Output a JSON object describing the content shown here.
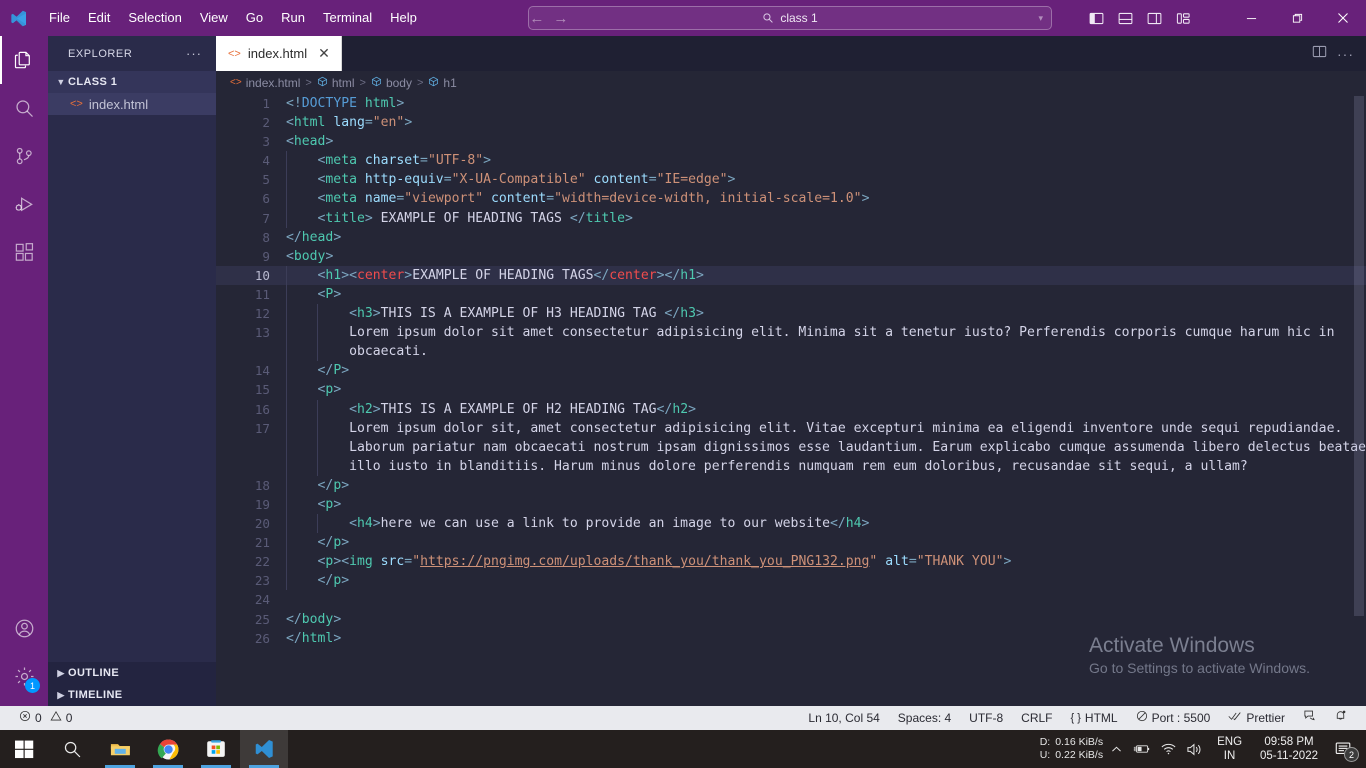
{
  "titlebar": {
    "logo_icon": "vscode-logo-icon",
    "menus": [
      "File",
      "Edit",
      "Selection",
      "View",
      "Go",
      "Run",
      "Terminal",
      "Help"
    ],
    "back_icon": "arrow-left-icon",
    "forward_icon": "arrow-right-icon",
    "command_center": {
      "search_icon": "search-icon",
      "value": "class 1",
      "chevron_icon": "chevron-down-icon"
    },
    "layout_buttons": [
      {
        "name": "toggle-primary-sidebar",
        "icon": "layout-sidebar-left-icon"
      },
      {
        "name": "toggle-panel",
        "icon": "layout-panel-icon"
      },
      {
        "name": "toggle-secondary-sidebar",
        "icon": "layout-sidebar-right-icon"
      },
      {
        "name": "customize-layout",
        "icon": "layout-customize-icon"
      }
    ],
    "window_buttons": {
      "minimize": "minimize-icon",
      "maximize": "restore-icon",
      "close": "close-icon"
    },
    "accent_color": "#68217a"
  },
  "activitybar": {
    "items": [
      {
        "name": "explorer",
        "icon": "files-icon",
        "active": true
      },
      {
        "name": "search",
        "icon": "search-icon",
        "active": false
      },
      {
        "name": "source-control",
        "icon": "source-control-icon",
        "active": false
      },
      {
        "name": "run-and-debug",
        "icon": "debug-icon",
        "active": false
      },
      {
        "name": "extensions",
        "icon": "extensions-icon",
        "active": false
      }
    ],
    "bottom": [
      {
        "name": "accounts",
        "icon": "account-icon"
      },
      {
        "name": "manage-settings",
        "icon": "gear-icon",
        "badge": "1"
      }
    ]
  },
  "sidebar": {
    "title": "EXPLORER",
    "more_actions": "···",
    "folder": {
      "label": "CLASS 1",
      "expanded": true
    },
    "files": [
      {
        "label": "index.html",
        "icon": "html-file-icon",
        "selected": true
      }
    ],
    "sections": [
      {
        "label": "OUTLINE",
        "expanded": false
      },
      {
        "label": "TIMELINE",
        "expanded": false
      }
    ]
  },
  "editor": {
    "tabs": [
      {
        "label": "index.html",
        "icon": "html-file-icon",
        "active": true,
        "close_icon": "close-icon"
      }
    ],
    "tab_actions": [
      {
        "name": "split-editor",
        "icon": "split-editor-icon"
      },
      {
        "name": "more-actions",
        "icon": "ellipsis-icon"
      }
    ],
    "breadcrumb": [
      "index.html",
      "html",
      "body",
      "h1"
    ],
    "watermark": {
      "title": "Activate Windows",
      "subtitle": "Go to Settings to activate Windows."
    },
    "current_line": 10,
    "lines": [
      {
        "n": 1,
        "indent": 0,
        "tokens": [
          {
            "c": "br",
            "t": "<!"
          },
          {
            "c": "dt",
            "t": "DOCTYPE"
          },
          {
            "c": "txt",
            "t": " "
          },
          {
            "c": "t",
            "t": "html"
          },
          {
            "c": "br",
            "t": ">"
          }
        ]
      },
      {
        "n": 2,
        "indent": 0,
        "tokens": [
          {
            "c": "br",
            "t": "<"
          },
          {
            "c": "t",
            "t": "html"
          },
          {
            "c": "txt",
            "t": " "
          },
          {
            "c": "a",
            "t": "lang"
          },
          {
            "c": "br",
            "t": "="
          },
          {
            "c": "s",
            "t": "\"en\""
          },
          {
            "c": "br",
            "t": ">"
          }
        ]
      },
      {
        "n": 3,
        "indent": 0,
        "tokens": [
          {
            "c": "br",
            "t": "<"
          },
          {
            "c": "t",
            "t": "head"
          },
          {
            "c": "br",
            "t": ">"
          }
        ]
      },
      {
        "n": 4,
        "indent": 1,
        "tokens": [
          {
            "c": "br",
            "t": "    <"
          },
          {
            "c": "t",
            "t": "meta"
          },
          {
            "c": "txt",
            "t": " "
          },
          {
            "c": "a",
            "t": "charset"
          },
          {
            "c": "br",
            "t": "="
          },
          {
            "c": "s",
            "t": "\"UTF-8\""
          },
          {
            "c": "br",
            "t": ">"
          }
        ]
      },
      {
        "n": 5,
        "indent": 1,
        "tokens": [
          {
            "c": "br",
            "t": "    <"
          },
          {
            "c": "t",
            "t": "meta"
          },
          {
            "c": "txt",
            "t": " "
          },
          {
            "c": "a",
            "t": "http-equiv"
          },
          {
            "c": "br",
            "t": "="
          },
          {
            "c": "s",
            "t": "\"X-UA-Compatible\""
          },
          {
            "c": "txt",
            "t": " "
          },
          {
            "c": "a",
            "t": "content"
          },
          {
            "c": "br",
            "t": "="
          },
          {
            "c": "s",
            "t": "\"IE=edge\""
          },
          {
            "c": "br",
            "t": ">"
          }
        ]
      },
      {
        "n": 6,
        "indent": 1,
        "tokens": [
          {
            "c": "br",
            "t": "    <"
          },
          {
            "c": "t",
            "t": "meta"
          },
          {
            "c": "txt",
            "t": " "
          },
          {
            "c": "a",
            "t": "name"
          },
          {
            "c": "br",
            "t": "="
          },
          {
            "c": "s",
            "t": "\"viewport\""
          },
          {
            "c": "txt",
            "t": " "
          },
          {
            "c": "a",
            "t": "content"
          },
          {
            "c": "br",
            "t": "="
          },
          {
            "c": "s",
            "t": "\"width=device-width, initial-scale=1.0\""
          },
          {
            "c": "br",
            "t": ">"
          }
        ]
      },
      {
        "n": 7,
        "indent": 1,
        "tokens": [
          {
            "c": "br",
            "t": "    <"
          },
          {
            "c": "t",
            "t": "title"
          },
          {
            "c": "br",
            "t": ">"
          },
          {
            "c": "txt",
            "t": " EXAMPLE OF HEADING TAGS "
          },
          {
            "c": "br",
            "t": "</"
          },
          {
            "c": "t",
            "t": "title"
          },
          {
            "c": "br",
            "t": ">"
          }
        ]
      },
      {
        "n": 8,
        "indent": 0,
        "tokens": [
          {
            "c": "br",
            "t": "</"
          },
          {
            "c": "t",
            "t": "head"
          },
          {
            "c": "br",
            "t": ">"
          }
        ]
      },
      {
        "n": 9,
        "indent": 0,
        "tokens": [
          {
            "c": "br",
            "t": "<"
          },
          {
            "c": "t",
            "t": "body"
          },
          {
            "c": "br",
            "t": ">"
          }
        ]
      },
      {
        "n": 10,
        "indent": 1,
        "tokens": [
          {
            "c": "br",
            "t": "    <"
          },
          {
            "c": "t",
            "t": "h1"
          },
          {
            "c": "br",
            "t": "><"
          },
          {
            "c": "dep",
            "t": "center"
          },
          {
            "c": "br",
            "t": ">"
          },
          {
            "c": "txt",
            "t": "EXAMPLE OF HEADING TAGS"
          },
          {
            "c": "br",
            "t": "</"
          },
          {
            "c": "dep",
            "t": "center"
          },
          {
            "c": "br",
            "t": "></"
          },
          {
            "c": "t",
            "t": "h1"
          },
          {
            "c": "br",
            "t": ">"
          }
        ]
      },
      {
        "n": 11,
        "indent": 1,
        "tokens": [
          {
            "c": "br",
            "t": "    <"
          },
          {
            "c": "t",
            "t": "P"
          },
          {
            "c": "br",
            "t": ">"
          }
        ]
      },
      {
        "n": 12,
        "indent": 2,
        "tokens": [
          {
            "c": "br",
            "t": "        <"
          },
          {
            "c": "t",
            "t": "h3"
          },
          {
            "c": "br",
            "t": ">"
          },
          {
            "c": "txt",
            "t": "THIS IS A EXAMPLE OF H3 HEADING TAG "
          },
          {
            "c": "br",
            "t": "</"
          },
          {
            "c": "t",
            "t": "h3"
          },
          {
            "c": "br",
            "t": ">"
          }
        ]
      },
      {
        "n": 13,
        "indent": 2,
        "tokens": [
          {
            "c": "txt",
            "t": "        Lorem ipsum dolor sit amet consectetur adipisicing elit. Minima sit a tenetur iusto? Perferendis corporis cumque harum hic in"
          }
        ]
      },
      {
        "n": null,
        "indent": 2,
        "tokens": [
          {
            "c": "txt",
            "t": "        obcaecati."
          }
        ]
      },
      {
        "n": 14,
        "indent": 1,
        "tokens": [
          {
            "c": "br",
            "t": "    </"
          },
          {
            "c": "t",
            "t": "P"
          },
          {
            "c": "br",
            "t": ">"
          }
        ]
      },
      {
        "n": 15,
        "indent": 1,
        "tokens": [
          {
            "c": "br",
            "t": "    <"
          },
          {
            "c": "t",
            "t": "p"
          },
          {
            "c": "br",
            "t": ">"
          }
        ]
      },
      {
        "n": 16,
        "indent": 2,
        "tokens": [
          {
            "c": "br",
            "t": "        <"
          },
          {
            "c": "t",
            "t": "h2"
          },
          {
            "c": "br",
            "t": ">"
          },
          {
            "c": "txt",
            "t": "THIS IS A EXAMPLE OF H2 HEADING TAG"
          },
          {
            "c": "br",
            "t": "</"
          },
          {
            "c": "t",
            "t": "h2"
          },
          {
            "c": "br",
            "t": ">"
          }
        ]
      },
      {
        "n": 17,
        "indent": 2,
        "tokens": [
          {
            "c": "txt",
            "t": "        Lorem ipsum dolor sit, amet consectetur adipisicing elit. Vitae excepturi minima ea eligendi inventore unde sequi repudiandae."
          }
        ]
      },
      {
        "n": null,
        "indent": 2,
        "tokens": [
          {
            "c": "txt",
            "t": "        Laborum pariatur nam obcaecati nostrum ipsam dignissimos esse laudantium. Earum explicabo cumque assumenda libero delectus beatae"
          }
        ]
      },
      {
        "n": null,
        "indent": 2,
        "tokens": [
          {
            "c": "txt",
            "t": "        illo iusto in blanditiis. Harum minus dolore perferendis numquam rem eum doloribus, recusandae sit sequi, a ullam?"
          }
        ]
      },
      {
        "n": 18,
        "indent": 1,
        "tokens": [
          {
            "c": "br",
            "t": "    </"
          },
          {
            "c": "t",
            "t": "p"
          },
          {
            "c": "br",
            "t": ">"
          }
        ]
      },
      {
        "n": 19,
        "indent": 1,
        "tokens": [
          {
            "c": "br",
            "t": "    <"
          },
          {
            "c": "t",
            "t": "p"
          },
          {
            "c": "br",
            "t": ">"
          }
        ]
      },
      {
        "n": 20,
        "indent": 2,
        "tokens": [
          {
            "c": "br",
            "t": "        <"
          },
          {
            "c": "t",
            "t": "h4"
          },
          {
            "c": "br",
            "t": ">"
          },
          {
            "c": "txt",
            "t": "here we can use a link to provide an image to our website"
          },
          {
            "c": "br",
            "t": "</"
          },
          {
            "c": "t",
            "t": "h4"
          },
          {
            "c": "br",
            "t": ">"
          }
        ]
      },
      {
        "n": 21,
        "indent": 1,
        "tokens": [
          {
            "c": "br",
            "t": "    </"
          },
          {
            "c": "t",
            "t": "p"
          },
          {
            "c": "br",
            "t": ">"
          }
        ]
      },
      {
        "n": 22,
        "indent": 1,
        "tokens": [
          {
            "c": "br",
            "t": "    <"
          },
          {
            "c": "t",
            "t": "p"
          },
          {
            "c": "br",
            "t": "><"
          },
          {
            "c": "t",
            "t": "img"
          },
          {
            "c": "txt",
            "t": " "
          },
          {
            "c": "a",
            "t": "src"
          },
          {
            "c": "br",
            "t": "="
          },
          {
            "c": "s",
            "t": "\""
          },
          {
            "c": "lnk",
            "t": "https://pngimg.com/uploads/thank_you/thank_you_PNG132.png"
          },
          {
            "c": "s",
            "t": "\""
          },
          {
            "c": "txt",
            "t": " "
          },
          {
            "c": "a",
            "t": "alt"
          },
          {
            "c": "br",
            "t": "="
          },
          {
            "c": "s",
            "t": "\"THANK YOU\""
          },
          {
            "c": "br",
            "t": ">"
          }
        ]
      },
      {
        "n": 23,
        "indent": 1,
        "tokens": [
          {
            "c": "br",
            "t": "    </"
          },
          {
            "c": "t",
            "t": "p"
          },
          {
            "c": "br",
            "t": ">"
          }
        ]
      },
      {
        "n": 24,
        "indent": 0,
        "tokens": []
      },
      {
        "n": 25,
        "indent": 0,
        "tokens": [
          {
            "c": "br",
            "t": "</"
          },
          {
            "c": "t",
            "t": "body"
          },
          {
            "c": "br",
            "t": ">"
          }
        ]
      },
      {
        "n": 26,
        "indent": 0,
        "tokens": [
          {
            "c": "br",
            "t": "</"
          },
          {
            "c": "t",
            "t": "html"
          },
          {
            "c": "br",
            "t": ">"
          }
        ]
      }
    ]
  },
  "statusbar": {
    "left": [
      {
        "name": "problems",
        "error_icon": "error-circle-icon",
        "errors": "0",
        "warning_icon": "warning-triangle-icon",
        "warnings": "0"
      }
    ],
    "right": [
      {
        "name": "editor-position",
        "label": "Ln 10, Col 54"
      },
      {
        "name": "editor-indentation",
        "label": "Spaces: 4"
      },
      {
        "name": "editor-encoding",
        "label": "UTF-8"
      },
      {
        "name": "editor-eol",
        "label": "CRLF"
      },
      {
        "name": "editor-language",
        "label": "HTML",
        "icon": "braces-icon"
      },
      {
        "name": "live-server-port",
        "label": "Port : 5500",
        "icon": "circle-slash-icon"
      },
      {
        "name": "prettier",
        "label": "Prettier",
        "icon": "check-check-icon"
      },
      {
        "name": "feedback",
        "label": "",
        "icon": "feedback-icon"
      },
      {
        "name": "notifications",
        "label": "",
        "icon": "bell-dot-icon"
      }
    ]
  },
  "taskbar": {
    "buttons": [
      {
        "name": "start-button",
        "icon": "windows-logo-icon"
      },
      {
        "name": "search-button",
        "icon": "search-icon"
      },
      {
        "name": "file-explorer",
        "icon": "folder-icon",
        "running": true
      },
      {
        "name": "chrome",
        "icon": "chrome-icon",
        "running": true
      },
      {
        "name": "microsoft-store",
        "icon": "store-icon",
        "running": true
      },
      {
        "name": "vscode",
        "icon": "vscode-logo-icon",
        "running": true,
        "active": true
      }
    ],
    "tray": {
      "net_down_label": "D:",
      "net_up_label": "U:",
      "net_down_value": "0.16 KiB/s",
      "net_up_value": "0.22 KiB/s",
      "overflow_icon": "chevron-up-icon",
      "battery_icon": "battery-charging-icon",
      "wifi_icon": "wifi-icon",
      "volume_icon": "speaker-icon",
      "language_line1": "ENG",
      "language_line2": "IN",
      "time": "09:58 PM",
      "date": "05-11-2022",
      "notification_icon": "notification-icon",
      "notification_count": "2"
    }
  }
}
